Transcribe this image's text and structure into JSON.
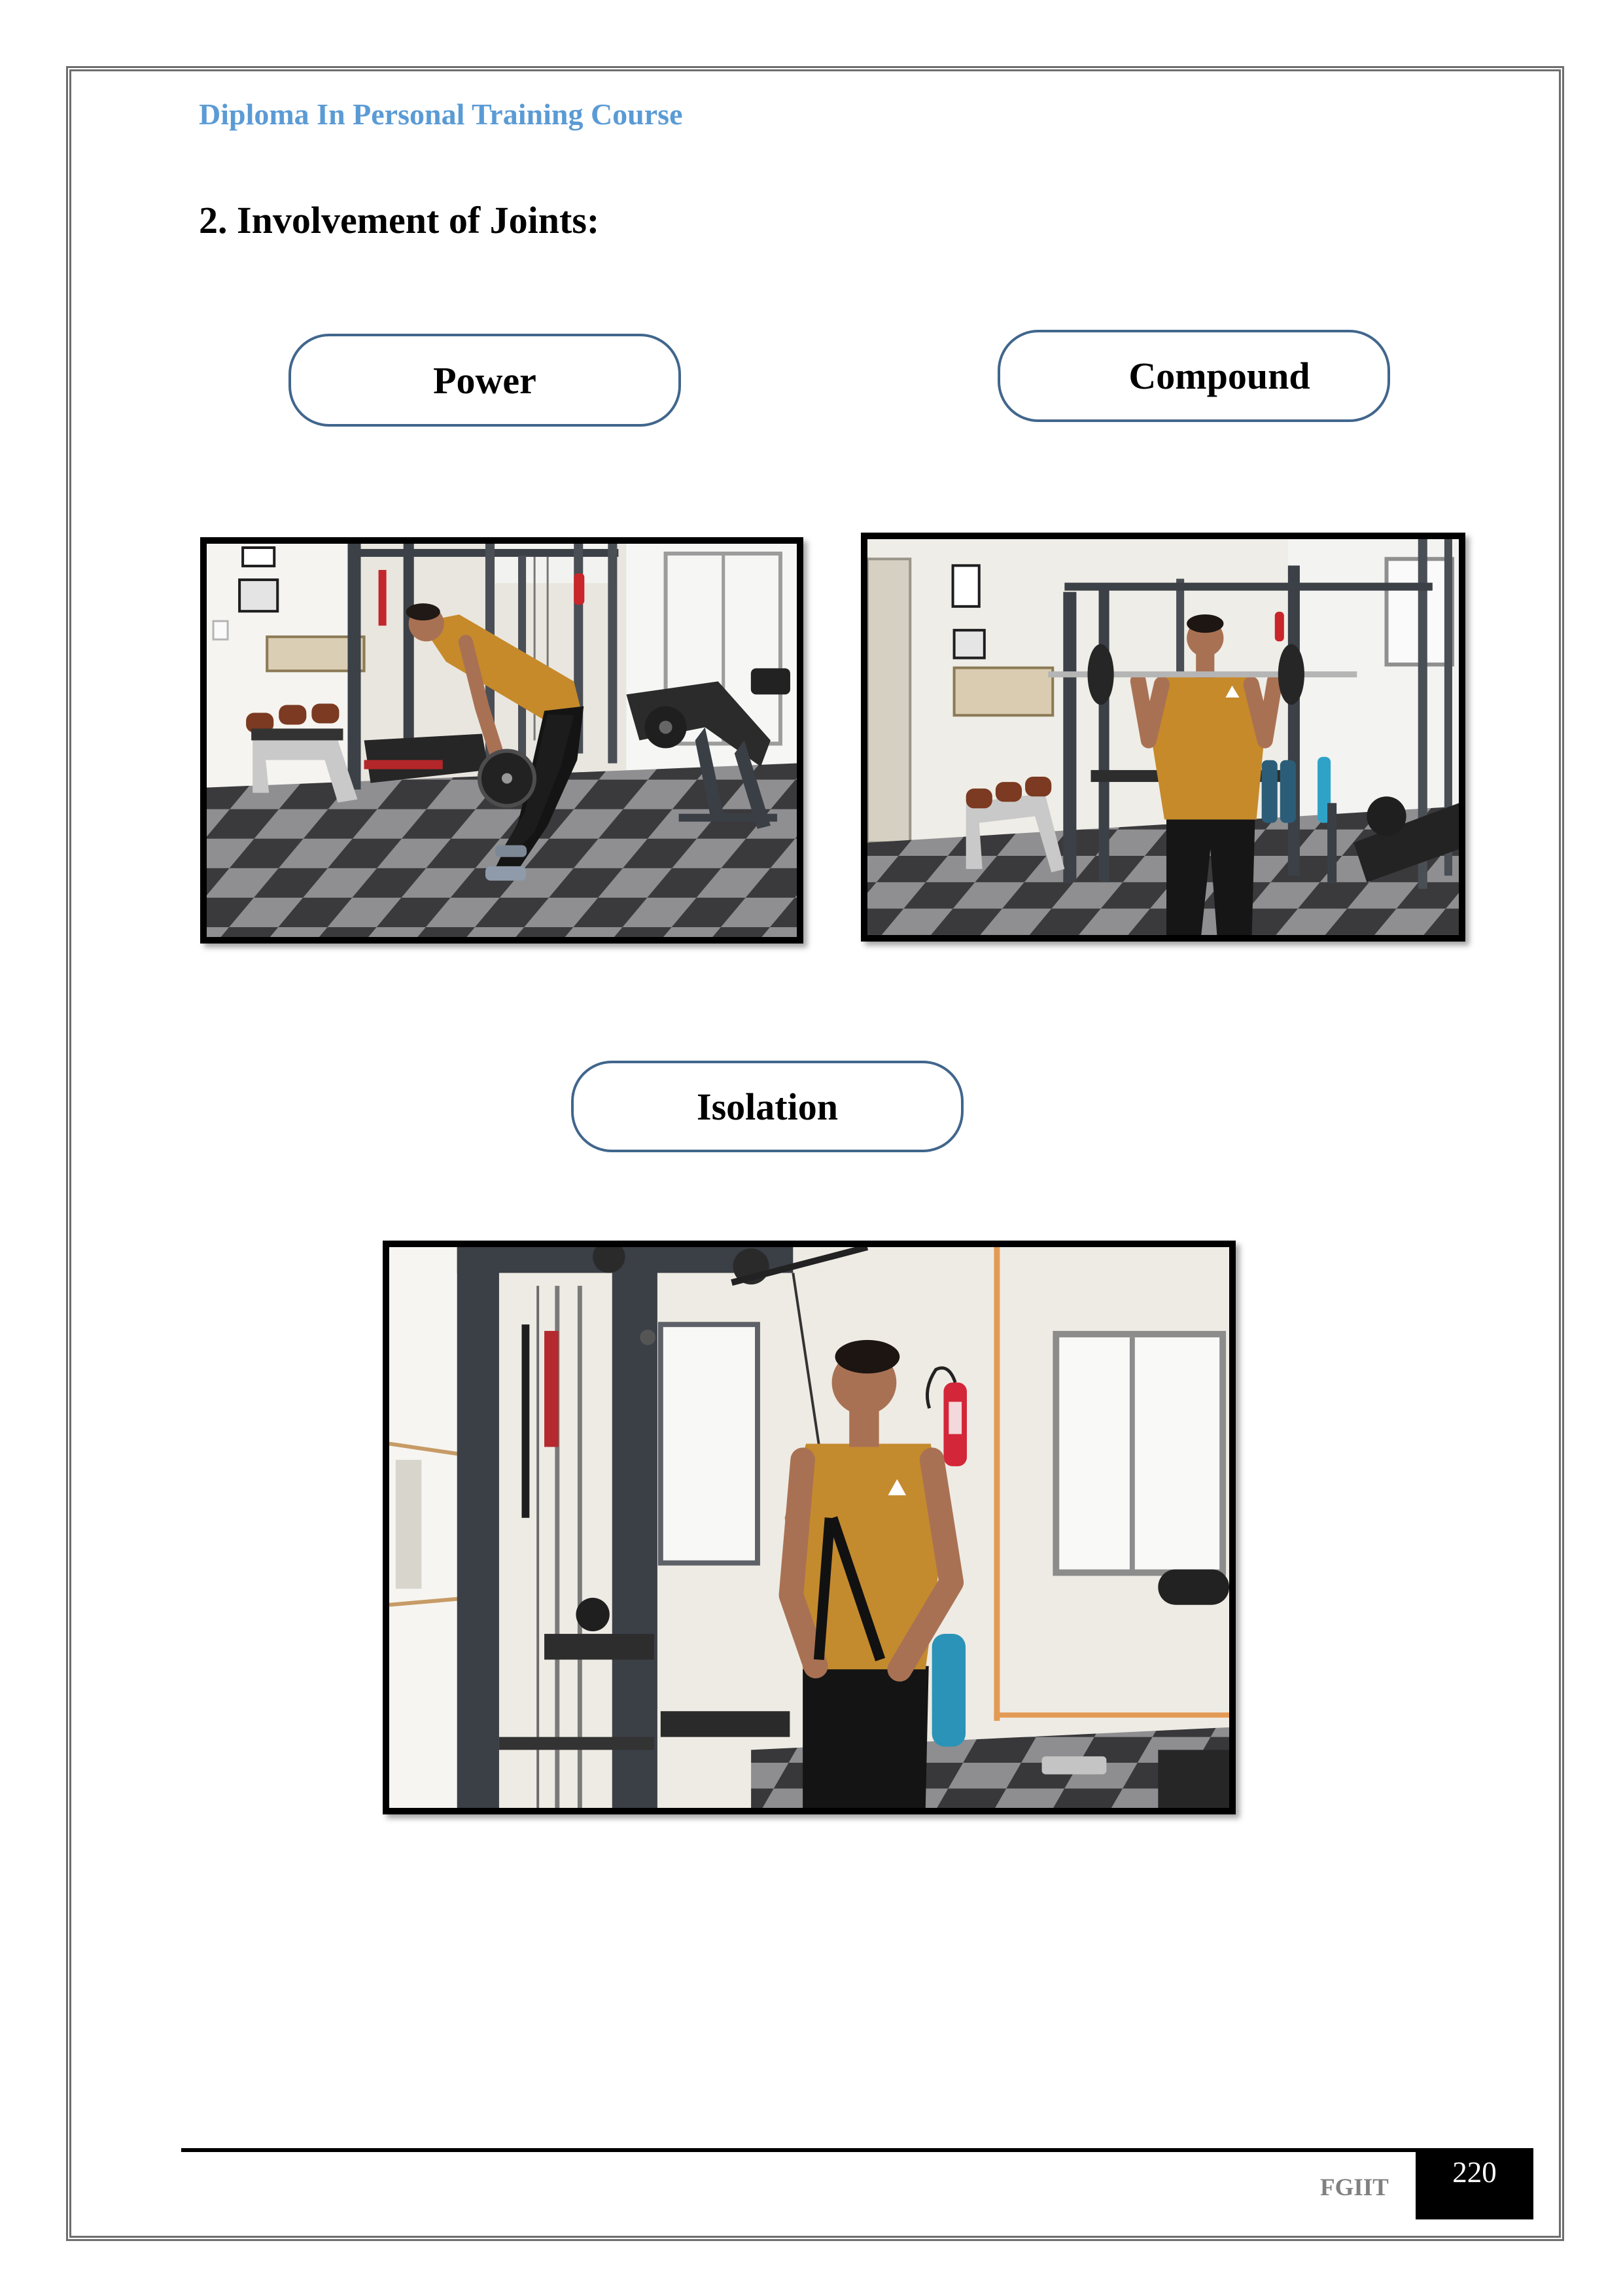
{
  "header": {
    "course_title": "Diploma In Personal Training Course"
  },
  "section": {
    "heading": "2. Involvement of Joints:"
  },
  "categories": {
    "power": "Power",
    "compound": "Compound",
    "isolation": "Isolation"
  },
  "footer": {
    "brand": "FGIIT",
    "page_number": "220"
  },
  "colors": {
    "header_text": "#5b9bd5",
    "box_border": "#41668c",
    "page_border": "#6e6e6e",
    "footer_brand": "#808080",
    "page_number_box": "#000000"
  }
}
